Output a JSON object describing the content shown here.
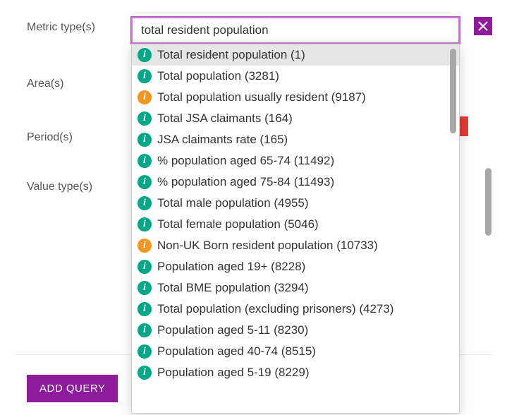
{
  "form": {
    "metric_label": "Metric type(s)",
    "area_label": "Area(s)",
    "period_label": "Period(s)",
    "value_label": "Value type(s)"
  },
  "search": {
    "value": "total resident population",
    "placeholder": ""
  },
  "close_glyph": "×",
  "minus_glyph": "-",
  "add_query_label": "ADD QUERY",
  "dropdown": {
    "items": [
      {
        "icon": "green",
        "label": "Total resident population (1)",
        "highlight": true
      },
      {
        "icon": "green",
        "label": "Total population (3281)"
      },
      {
        "icon": "orange",
        "label": "Total population usually resident (9187)"
      },
      {
        "icon": "green",
        "label": "Total JSA claimants (164)"
      },
      {
        "icon": "green",
        "label": "JSA claimants rate (165)"
      },
      {
        "icon": "green",
        "label": "% population aged 65-74 (11492)"
      },
      {
        "icon": "green",
        "label": "% population aged 75-84 (11493)"
      },
      {
        "icon": "green",
        "label": "Total male population (4955)"
      },
      {
        "icon": "green",
        "label": "Total female population (5046)"
      },
      {
        "icon": "orange",
        "label": "Non-UK Born resident population (10733)"
      },
      {
        "icon": "green",
        "label": "Population aged 19+ (8228)"
      },
      {
        "icon": "green",
        "label": "Total BME population (3294)"
      },
      {
        "icon": "green",
        "label": "Total population (excluding prisoners) (4273)"
      },
      {
        "icon": "green",
        "label": "Population aged 5-11 (8230)"
      },
      {
        "icon": "green",
        "label": "Population aged 40-74 (8515)"
      },
      {
        "icon": "green",
        "label": "Population aged 5-19 (8229)"
      }
    ]
  }
}
